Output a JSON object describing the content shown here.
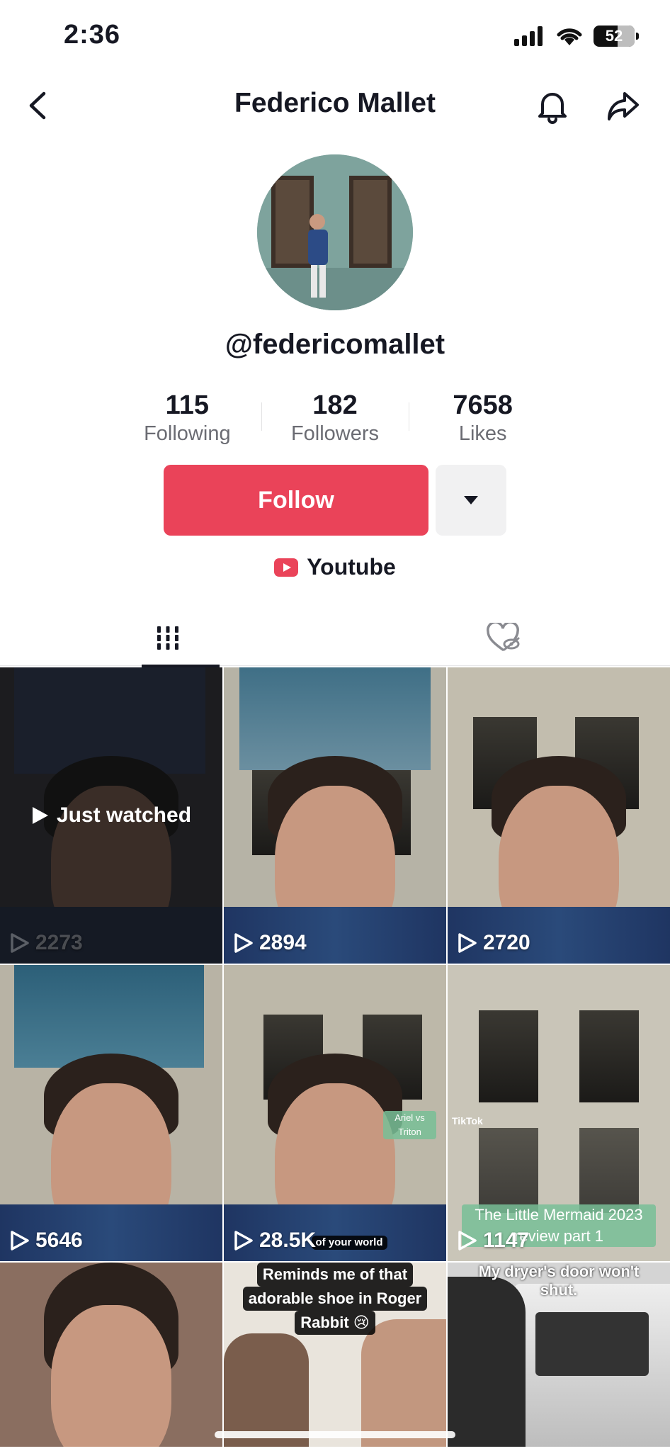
{
  "status_bar": {
    "time": "2:36",
    "battery": "52"
  },
  "header": {
    "title": "Federico Mallet"
  },
  "profile": {
    "username": "@federicomallet",
    "stats": [
      {
        "value": "115",
        "label": "Following"
      },
      {
        "value": "182",
        "label": "Followers"
      },
      {
        "value": "7658",
        "label": "Likes"
      }
    ],
    "follow_label": "Follow",
    "link_label": "Youtube"
  },
  "colors": {
    "accent": "#ea4359",
    "text": "#161823",
    "muted": "#6b6c73"
  },
  "tabs": [
    {
      "name": "videos",
      "icon": "grid-icon",
      "active": true
    },
    {
      "name": "liked",
      "icon": "heart-hidden-icon",
      "active": false
    }
  ],
  "videos": [
    {
      "views": "2273",
      "overlay": "Just watched"
    },
    {
      "views": "2894"
    },
    {
      "views": "2720"
    },
    {
      "views": "5646"
    },
    {
      "views": "28.5K",
      "captions": [
        "Ariel vs Triton",
        "of your world"
      ]
    },
    {
      "views": "1147",
      "captions": [
        "TikTok",
        "The Little Mermaid 2023",
        "review part 1"
      ]
    },
    {
      "views": ""
    },
    {
      "views": "",
      "captions": [
        "Reminds me of that",
        "adorable shoe in Roger",
        "Rabbit 😢"
      ]
    },
    {
      "views": "",
      "captions": [
        "My dryer's door won't",
        "shut."
      ]
    }
  ]
}
